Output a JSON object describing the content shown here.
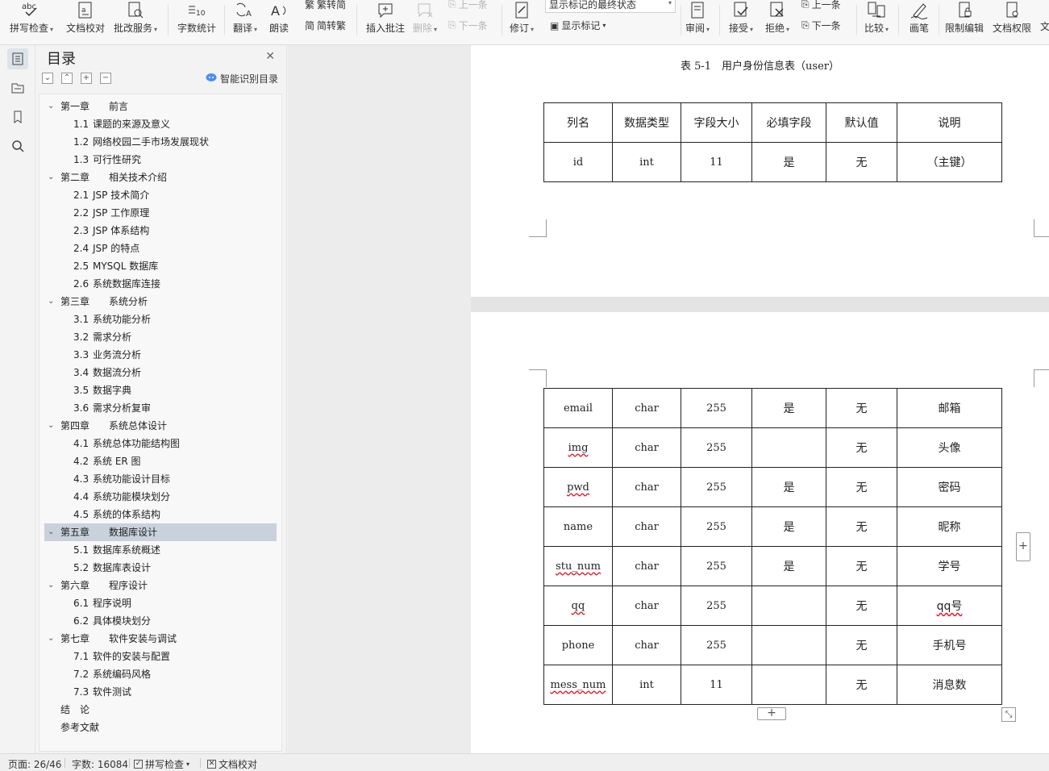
{
  "ribbon": {
    "spell_check": "拼写检查",
    "doc_proofread": "文档校对",
    "revise_service": "批改服务",
    "word_count": "字数统计",
    "translate": "翻译",
    "read_aloud": "朗读",
    "trad_to_simp": "繁转简",
    "simp_to_trad": "简转繁",
    "insert_comment": "插入批注",
    "delete": "删除",
    "prev_comment": "上一条",
    "next_comment": "下一条",
    "track_changes": "修订",
    "show_markup_state": "显示标记的最终状态",
    "show_markup": "显示标记",
    "review": "审阅",
    "accept": "接受",
    "reject": "拒绝",
    "prev_change": "上一条",
    "next_change": "下一条",
    "compare": "比较",
    "ink": "画笔",
    "restrict_editing": "限制编辑",
    "doc_permission": "文档权限",
    "overflow_text": "文"
  },
  "toc": {
    "title": "目录",
    "smart_recognize": "智能识别目录",
    "items": [
      {
        "num": "第一章",
        "text": "前言",
        "level": 1
      },
      {
        "num": "1.1",
        "text": "课题的来源及意义",
        "level": 2
      },
      {
        "num": "1.2",
        "text": "网络校园二手市场发展现状",
        "level": 2
      },
      {
        "num": "1.3",
        "text": "可行性研究",
        "level": 2
      },
      {
        "num": "第二章",
        "text": "相关技术介绍",
        "level": 1
      },
      {
        "num": "2.1",
        "text": "JSP 技术简介",
        "level": 2
      },
      {
        "num": "2.2",
        "text": "JSP 工作原理",
        "level": 2
      },
      {
        "num": "2.3",
        "text": "JSP 体系结构",
        "level": 2
      },
      {
        "num": "2.4",
        "text": "JSP 的特点",
        "level": 2
      },
      {
        "num": "2.5",
        "text": "MYSQL 数据库",
        "level": 2
      },
      {
        "num": "2.6",
        "text": "系统数据库连接",
        "level": 2
      },
      {
        "num": "第三章",
        "text": "系统分析",
        "level": 1
      },
      {
        "num": "3.1",
        "text": "系统功能分析",
        "level": 2
      },
      {
        "num": "3.2",
        "text": "需求分析",
        "level": 2
      },
      {
        "num": "3.3",
        "text": "业务流分析",
        "level": 2
      },
      {
        "num": "3.4",
        "text": "数据流分析",
        "level": 2
      },
      {
        "num": "3.5",
        "text": "数据字典",
        "level": 2
      },
      {
        "num": "3.6",
        "text": "需求分析复审",
        "level": 2
      },
      {
        "num": "第四章",
        "text": "系统总体设计",
        "level": 1
      },
      {
        "num": "4.1",
        "text": "系统总体功能结构图",
        "level": 2
      },
      {
        "num": "4.2",
        "text": "系统 ER 图",
        "level": 2
      },
      {
        "num": "4.3",
        "text": "系统功能设计目标",
        "level": 2
      },
      {
        "num": "4.4",
        "text": "系统功能模块划分",
        "level": 2
      },
      {
        "num": "4.5",
        "text": "系统的体系结构",
        "level": 2
      },
      {
        "num": "第五章",
        "text": "数据库设计",
        "level": 1,
        "selected": true
      },
      {
        "num": "5.1",
        "text": "数据库系统概述",
        "level": 2
      },
      {
        "num": "5.2",
        "text": "数据库表设计",
        "level": 2
      },
      {
        "num": "第六章",
        "text": "程序设计",
        "level": 1
      },
      {
        "num": "6.1",
        "text": "程序说明",
        "level": 2
      },
      {
        "num": "6.2",
        "text": "具体模块划分",
        "level": 2
      },
      {
        "num": "第七章",
        "text": "软件安装与调试",
        "level": 1
      },
      {
        "num": "7.1",
        "text": "软件的安装与配置",
        "level": 2
      },
      {
        "num": "7.2",
        "text": "系统编码风格",
        "level": 2
      },
      {
        "num": "7.3",
        "text": "软件测试",
        "level": 2
      },
      {
        "num": "",
        "text": "结　论",
        "level": 0
      },
      {
        "num": "",
        "text": "参考文献",
        "level": 0
      }
    ]
  },
  "document": {
    "caption": "表 5-1　用户身份信息表（user）",
    "headers": [
      "列名",
      "数据类型",
      "字段大小",
      "必填字段",
      "默认值",
      "说明"
    ],
    "page1_rows": [
      [
        "id",
        "int",
        "11",
        "是",
        "无",
        "（主键）"
      ]
    ],
    "page2_rows": [
      [
        "email",
        "char",
        "255",
        "是",
        "无",
        "邮箱"
      ],
      [
        "img",
        "char",
        "255",
        "",
        "无",
        "头像"
      ],
      [
        "pwd",
        "char",
        "255",
        "是",
        "无",
        "密码"
      ],
      [
        "name",
        "char",
        "255",
        "是",
        "无",
        "昵称"
      ],
      [
        "stu_num",
        "char",
        "255",
        "是",
        "无",
        "学号"
      ],
      [
        "qq",
        "char",
        "255",
        "",
        "无",
        "qq号"
      ],
      [
        "phone",
        "char",
        "255",
        "",
        "无",
        "手机号"
      ],
      [
        "mess_num",
        "int",
        "11",
        "",
        "无",
        "消息数"
      ]
    ],
    "spell_flagged": [
      "img",
      "pwd",
      "stu_num",
      "qq",
      "mess_num",
      "qq号"
    ]
  },
  "status": {
    "page": "页面: 26/46",
    "word_count": "字数: 16084",
    "spell_check": "拼写检查",
    "doc_proofread": "文档校对"
  }
}
